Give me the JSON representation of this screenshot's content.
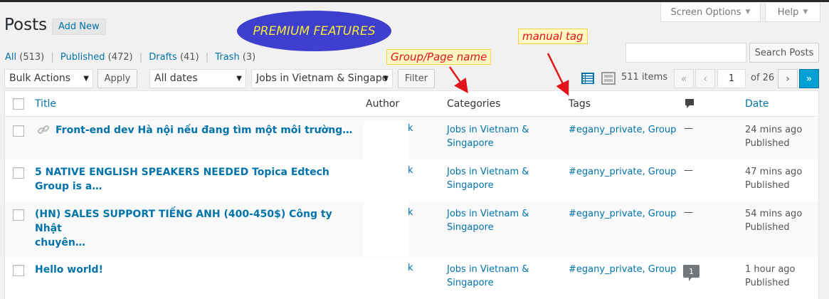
{
  "header": {
    "screen_options": "Screen Options",
    "help": "Help",
    "title": "Posts",
    "add_new": "Add New"
  },
  "filters": {
    "all_label": "All",
    "all_count": "(513)",
    "published_label": "Published",
    "published_count": "(472)",
    "drafts_label": "Drafts",
    "drafts_count": "(41)",
    "trash_label": "Trash",
    "trash_count": "(3)",
    "separator": "|"
  },
  "search": {
    "button": "Search Posts",
    "value": ""
  },
  "tablenav": {
    "bulk_actions": "Bulk Actions",
    "apply": "Apply",
    "dates": "All dates",
    "category": "Jobs in Vietnam & Singapo",
    "filter": "Filter",
    "items": "511 items",
    "first": "«",
    "prev": "‹",
    "current_page": "1",
    "of_pages": "of 26",
    "next": "›",
    "last": "»"
  },
  "columns": {
    "title": "Title",
    "author": "Author",
    "categories": "Categories",
    "tags": "Tags",
    "date": "Date"
  },
  "rows": [
    {
      "title": "Front-end dev Hà nội nếu đang tìm một môi trường…",
      "author_fragment": "k",
      "category_line1": "Jobs in Vietnam &",
      "category_line2": "Singapore",
      "tags": "#egany_private, Group",
      "comments": "—",
      "date_line1": "24 mins ago",
      "date_line2": "Published"
    },
    {
      "title": "5 NATIVE ENGLISH SPEAKERS NEEDED Topica Edtech Group is a…",
      "author_fragment": "k",
      "category_line1": "Jobs in Vietnam &",
      "category_line2": "Singapore",
      "tags": "#egany_private, Group",
      "comments": "—",
      "date_line1": "47 mins ago",
      "date_line2": "Published"
    },
    {
      "title_line1": "(HN) SALES SUPPORT TIẾNG ANH (400-450$) Công ty Nhật",
      "title_line2": "chuyên…",
      "author_fragment": "k",
      "category_line1": "Jobs in Vietnam &",
      "category_line2": "Singapore",
      "tags": "#egany_private, Group",
      "comments": "—",
      "date_line1": "54 mins ago",
      "date_line2": "Published"
    },
    {
      "title": "Hello world!",
      "author_fragment": "k",
      "category_line1": "Jobs in Vietnam &",
      "category_line2": "Singapore",
      "tags": "#egany_private, Group",
      "comments": "1",
      "date_line1": "1 hour ago",
      "date_line2": "Published"
    }
  ],
  "annotations": {
    "premium": "PREMIUM FEATURES",
    "group_page": "Group/Page name",
    "manual_tag": "manual tag"
  },
  "colors": {
    "link": "#0073aa",
    "annotation_red": "#e1141a",
    "premium_bg": "#3f3fcf",
    "premium_text": "#f4e93a",
    "primary_blue": "#00a0d2"
  }
}
